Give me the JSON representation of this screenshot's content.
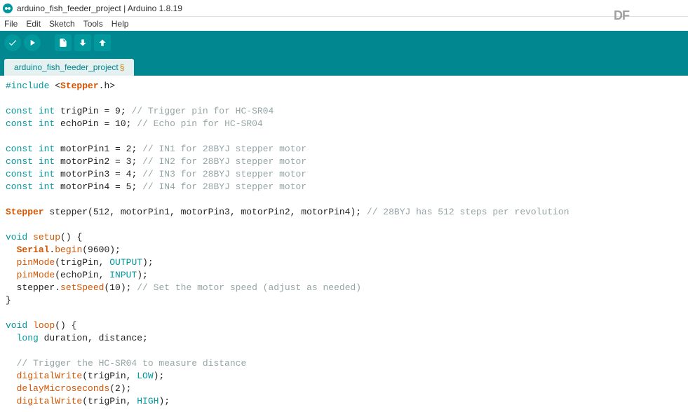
{
  "window": {
    "title": "arduino_fish_feeder_project | Arduino 1.8.19"
  },
  "logo": "DF",
  "menu": {
    "file": "File",
    "edit": "Edit",
    "sketch": "Sketch",
    "tools": "Tools",
    "help": "Help"
  },
  "tab": {
    "name": "arduino_fish_feeder_project",
    "modified": "§"
  },
  "code": {
    "l1_include": "#include",
    "l1_open": " <",
    "l1_stepper": "Stepper",
    "l1_close": ".h>",
    "const": "const",
    "int": "int",
    "l3_var": " trigPin = 9; ",
    "l3_cmt": "// Trigger pin for HC-SR04",
    "l4_var": " echoPin = 10; ",
    "l4_cmt": "// Echo pin for HC-SR04",
    "l6_var": " motorPin1 = 2; ",
    "l6_cmt": "// IN1 for 28BYJ stepper motor",
    "l7_var": " motorPin2 = 3; ",
    "l7_cmt": "// IN2 for 28BYJ stepper motor",
    "l8_var": " motorPin3 = 4; ",
    "l8_cmt": "// IN3 for 28BYJ stepper motor",
    "l9_var": " motorPin4 = 5; ",
    "l9_cmt": "// IN4 for 28BYJ stepper motor",
    "l11_stepper": "Stepper",
    "l11_rest": " stepper(512, motorPin1, motorPin3, motorPin2, motorPin4); ",
    "l11_cmt": "// 28BYJ has 512 steps per revolution",
    "void": "void",
    "l13_setup": "setup",
    "l13_rest": "() {",
    "l14_ind": "  ",
    "l14_serial": "Serial",
    "l14_dot": ".",
    "l14_begin": "begin",
    "l14_rest": "(9600);",
    "l15_ind": "  ",
    "l15_pinmode": "pinMode",
    "l15_open": "(trigPin, ",
    "l15_output": "OUTPUT",
    "l15_close": ");",
    "l16_ind": "  ",
    "l16_pinmode": "pinMode",
    "l16_open": "(echoPin, ",
    "l16_input": "INPUT",
    "l16_close": ");",
    "l17_ind": "  stepper.",
    "l17_setspeed": "setSpeed",
    "l17_rest": "(10); ",
    "l17_cmt": "// Set the motor speed (adjust as needed)",
    "l18": "}",
    "l20_loop": "loop",
    "l20_rest": "() {",
    "l21_ind": "  ",
    "l21_long": "long",
    "l21_rest": " duration, distance;",
    "l23_cmt": "  // Trigger the HC-SR04 to measure distance",
    "l24_ind": "  ",
    "l24_dw": "digitalWrite",
    "l24_open": "(trigPin, ",
    "l24_low": "LOW",
    "l24_close": ");",
    "l25_ind": "  ",
    "l25_dm": "delayMicroseconds",
    "l25_rest": "(2);",
    "l26_ind": "  ",
    "l26_dw": "digitalWrite",
    "l26_open": "(trigPin, ",
    "l26_high": "HIGH",
    "l26_close": ");"
  }
}
